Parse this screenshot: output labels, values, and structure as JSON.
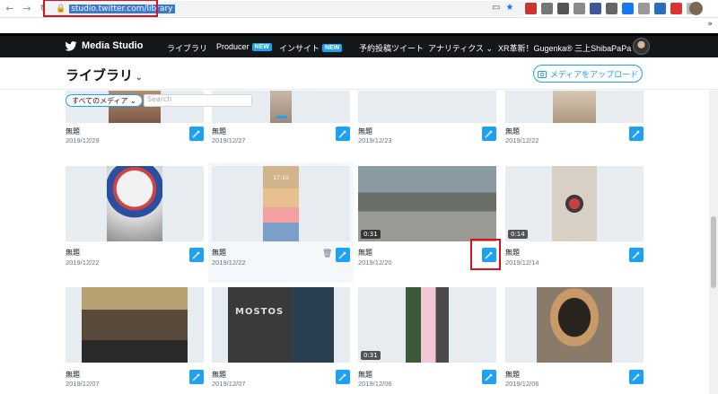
{
  "browser": {
    "url": "studio.twitter.com/library",
    "back_icon": "back-arrow-icon",
    "forward_icon": "forward-arrow-icon",
    "reload_icon": "reload-icon"
  },
  "header": {
    "brand": "Media Studio",
    "nav": [
      {
        "label": "ライブラリ",
        "badge": ""
      },
      {
        "label": "Producer",
        "badge": "NEW"
      },
      {
        "label": "インサイト",
        "badge": "NEW"
      },
      {
        "label": "予約投稿ツイート",
        "badge": ""
      },
      {
        "label": "アナリティクス ⌄",
        "badge": ""
      },
      {
        "label": "XR革新！Gugenka® 三上ShibaPaPa ⌄",
        "badge": ""
      }
    ]
  },
  "page": {
    "title": "ライブラリ",
    "upload_label": "メディアをアップロード",
    "filter_label": "すべてのメディア ⌄",
    "search_placeholder": "Search"
  },
  "cards": [
    {
      "title": "無題",
      "date": "2019/12/29",
      "duration": ""
    },
    {
      "title": "無題",
      "date": "2019/12/27",
      "duration": ""
    },
    {
      "title": "無題",
      "date": "2019/12/23",
      "duration": ""
    },
    {
      "title": "無題",
      "date": "2019/12/22",
      "duration": ""
    },
    {
      "title": "無題",
      "date": "2019/12/22",
      "duration": ""
    },
    {
      "title": "無題",
      "date": "2019/12/22",
      "duration": ""
    },
    {
      "title": "無題",
      "date": "2019/12/20",
      "duration": "0:31"
    },
    {
      "title": "無題",
      "date": "2019/12/14",
      "duration": "0:14"
    },
    {
      "title": "無題",
      "date": "2019/12/07",
      "duration": ""
    },
    {
      "title": "無題",
      "date": "2019/12/07",
      "duration": ""
    },
    {
      "title": "無題",
      "date": "2019/12/06",
      "duration": "0:31"
    },
    {
      "title": "無題",
      "date": "2019/12/06",
      "duration": ""
    }
  ],
  "thumb_text": {
    "lock_time": "17:10",
    "game_logo": "MOSTOS"
  },
  "colors": {
    "accent": "#1da1f2",
    "header_bg": "#14171a",
    "annotation_red": "#e0101a"
  }
}
